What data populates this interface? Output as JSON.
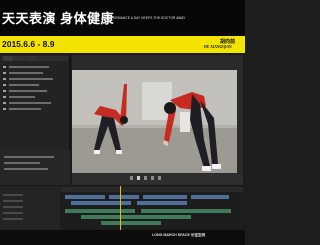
{
  "banner": {
    "title_cn": "天天表演 身体健康",
    "title_en": "A PERFORMANCE A DAY KEEPS THE DOCTOR AWAY",
    "date_range": "2015.6.6 - 8.9",
    "artist_cn": "胡向前",
    "artist_en": "HU XIANGQIAN",
    "yellow": "#f3e300"
  },
  "footer": {
    "venue": "LONG MARCH SPACE 长征空间"
  },
  "editor": {
    "accent": "#e6c200",
    "video_clip_color": "#4f6f9a",
    "audio_clip_color": "#3f7a5a",
    "icons": [
      "play-icon",
      "stop-icon",
      "step-back-icon",
      "step-forward-icon",
      "loop-icon"
    ]
  }
}
